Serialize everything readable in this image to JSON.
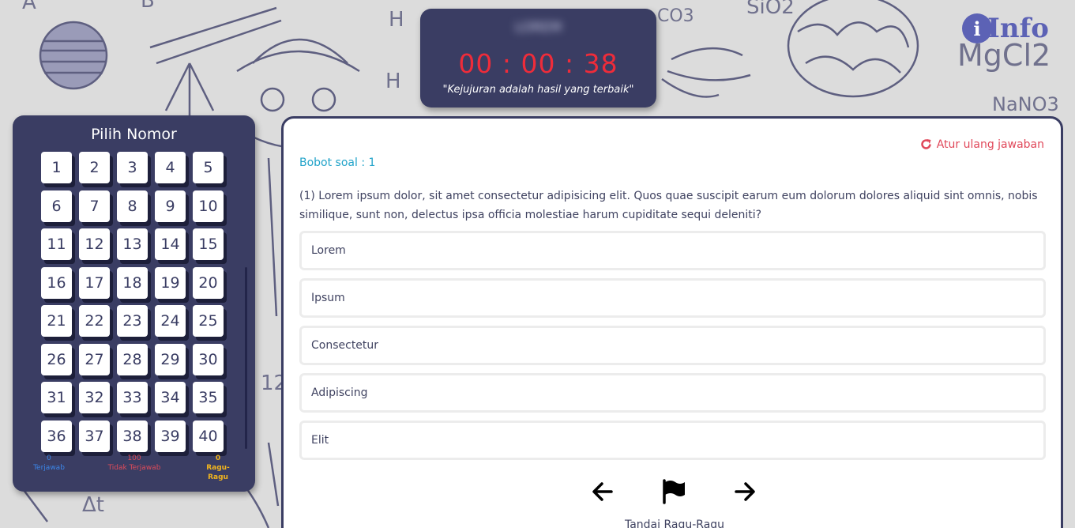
{
  "timer": {
    "name": "LOREM",
    "clock": "00 : 00 : 38",
    "quote": "\"Kejujuran adalah hasil yang terbaik\""
  },
  "info": {
    "icon": "info-icon",
    "label": "Info"
  },
  "panel": {
    "title": "Pilih Nomor",
    "numbers": [
      "1",
      "2",
      "3",
      "4",
      "5",
      "6",
      "7",
      "8",
      "9",
      "10",
      "11",
      "12",
      "13",
      "14",
      "15",
      "16",
      "17",
      "18",
      "19",
      "20",
      "21",
      "22",
      "23",
      "24",
      "25",
      "26",
      "27",
      "28",
      "29",
      "30",
      "31",
      "32",
      "33",
      "34",
      "35",
      "36",
      "37",
      "38",
      "39",
      "40"
    ],
    "legend": {
      "answered": {
        "count": "0",
        "label": "Terjawab",
        "color": "#3c86e8"
      },
      "unanswered": {
        "count": "100",
        "label": "Tidak Terjawab",
        "color": "#e04b5a"
      },
      "doubt": {
        "count": "0",
        "label": "Ragu-Ragu",
        "color": "#f2b51e"
      }
    }
  },
  "question": {
    "reset_icon": "redo-icon",
    "reset_label": "Atur ulang jawaban",
    "weight": "Bobot soal : 1",
    "text": "(1) Lorem ipsum dolor, sit amet consectetur adipisicing elit. Quos quae suscipit earum eum dolorum dolores aliquid sint omnis, nobis similique, sunt non, delectus ipsa officia molestiae harum cupiditate sequi deleniti?",
    "options": [
      "Lorem",
      "Ipsum",
      "Consectetur",
      "Adipiscing",
      "Elit"
    ],
    "nav": {
      "prev_icon": "arrow-left-icon",
      "flag_icon": "flag-icon",
      "next_icon": "arrow-right-icon",
      "flag_label": "Tandai Ragu-Ragu"
    }
  },
  "background": {
    "formulas": [
      "A",
      "B",
      "H",
      "H",
      "SiO2",
      "CO3",
      "MgCl2",
      "NaNO3",
      "Δt",
      "12"
    ]
  }
}
